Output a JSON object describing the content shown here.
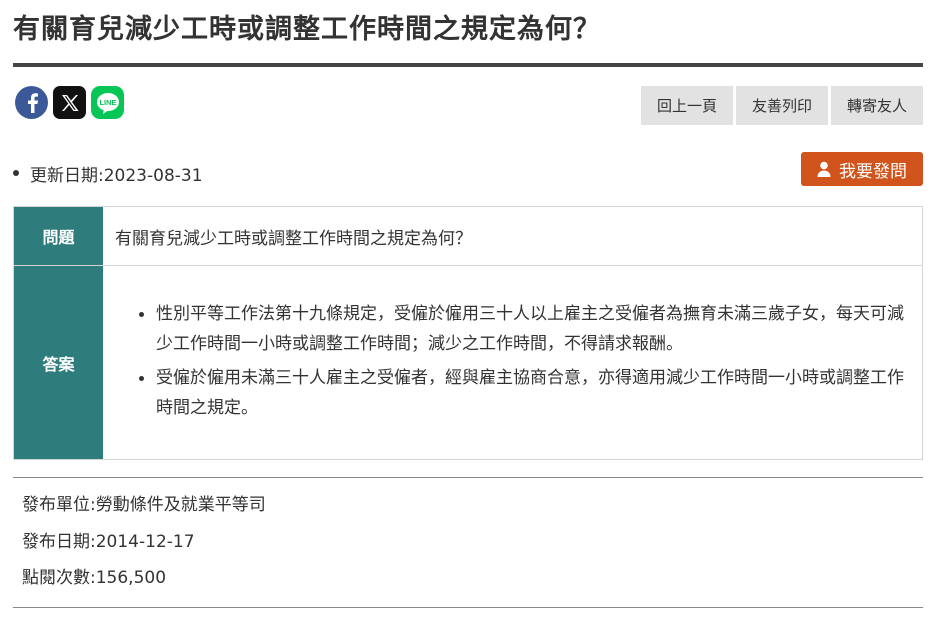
{
  "page_title": "有關育兒減少工時或調整工作時間之規定為何？",
  "share": {
    "facebook_icon": "facebook-icon",
    "x_icon": "x-icon",
    "line_icon": "line-icon",
    "line_text": "LINE",
    "colors": {
      "facebook": "#3b5998",
      "x": "#111111",
      "line": "#06c755"
    }
  },
  "toolbar": {
    "back_label": "回上一頁",
    "print_label": "友善列印",
    "forward_label": "轉寄友人"
  },
  "update": {
    "label": "更新日期:2023-08-31"
  },
  "ask_button": {
    "label": "我要發問",
    "icon": "user-icon",
    "color": "#d0541b"
  },
  "qa": {
    "question_header": "問題",
    "question_text": "有關育兒減少工時或調整工作時間之規定為何？",
    "answer_header": "答案",
    "answer_items": [
      "性別平等工作法第十九條規定，受僱於僱用三十人以上雇主之受僱者為撫育未滿三歲子女，每天可減少工作時間一小時或調整工作時間；減少之工作時間，不得請求報酬。",
      "受僱於僱用未滿三十人雇主之受僱者，經與雇主協商合意，亦得適用減少工作時間一小時或調整工作時間之規定。"
    ],
    "header_color": "#2e7c7c"
  },
  "meta": {
    "publisher": "發布單位:勞動條件及就業平等司",
    "publish_date": "發布日期:2014-12-17",
    "views": "點閱次數:156,500"
  }
}
